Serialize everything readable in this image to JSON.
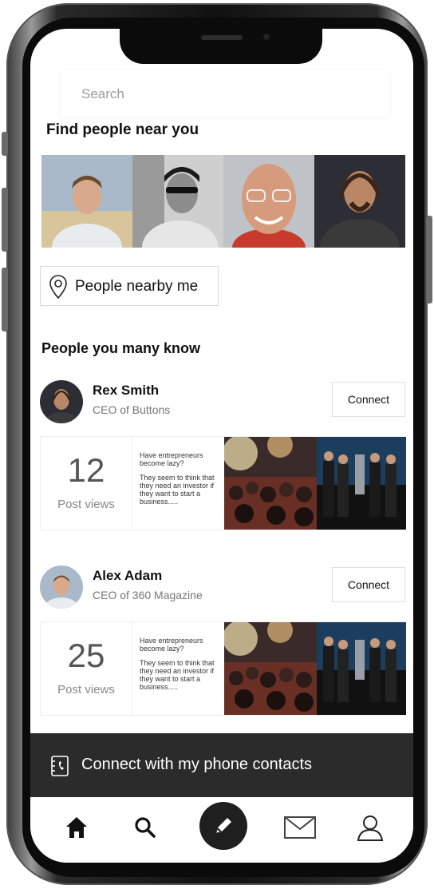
{
  "search": {
    "placeholder": "Search"
  },
  "find_people": {
    "heading": "Find people near you",
    "nearby_button": "People nearby me"
  },
  "people_you_may_know": {
    "heading": "People you many know",
    "people": [
      {
        "name": "Rex Smith",
        "title": "CEO of Buttons",
        "connect_label": "Connect",
        "post_views": "12",
        "post_views_label": "Post views",
        "post_text_1": "Have entrepreneurs become lazy?",
        "post_text_2": "They seem to think that they need an investor if they want to start a business....."
      },
      {
        "name": "Alex Adam",
        "title": "CEO of 360 Magazine",
        "connect_label": "Connect",
        "post_views": "25",
        "post_views_label": "Post views",
        "post_text_1": "Have entrepreneurs become lazy?",
        "post_text_2": "They seem to think that they need an investor if they want to start a business....."
      }
    ]
  },
  "contacts_bar": {
    "label": "Connect with my phone contacts",
    "icon": "phone-contacts-icon"
  },
  "tabbar": {
    "items": [
      {
        "icon": "home-icon"
      },
      {
        "icon": "search-icon"
      },
      {
        "icon": "pencil-icon"
      },
      {
        "icon": "mail-icon"
      },
      {
        "icon": "profile-icon"
      }
    ]
  },
  "colors": {
    "bar_background": "#2b2b2b",
    "accent": "#1f1f1f"
  }
}
